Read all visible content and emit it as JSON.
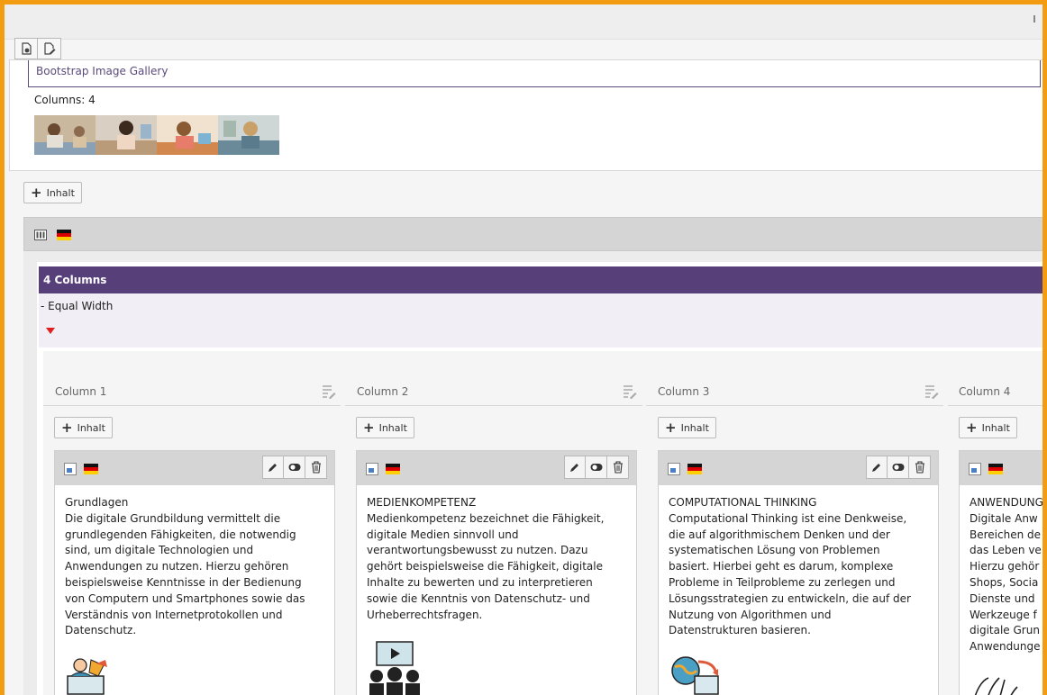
{
  "toolbar": {
    "buttons": [
      {
        "name": "view-icon"
      },
      {
        "name": "edit-page-icon"
      }
    ]
  },
  "gallery": {
    "title": "Bootstrap Image Gallery",
    "columns_label": "Columns: 4",
    "thumbnail_count": 4
  },
  "add_content_label": "Inhalt",
  "grid": {
    "header_icons": [
      "grid-element-icon",
      "german-flag-icon"
    ],
    "title": "4 Columns",
    "subtitle": "- Equal Width"
  },
  "columns": [
    {
      "title": "Column 1",
      "add_label": "Inhalt",
      "heading": "Grundlagen",
      "text": "Die digitale Grundbildung vermittelt die\ngrundlegenden Fähigkeiten, die notwendig\nsind, um digitale Technologien und\nAnwendungen zu nutzen. Hierzu gehören\nbeispielsweise Kenntnisse in der Bedienung\nvon Computern und Smartphones sowie das\nVerständnis von Internetprotokollen und\nDatenschutz."
    },
    {
      "title": "Column 2",
      "add_label": "Inhalt",
      "heading": "MEDIENKOMPETENZ",
      "text": "Medienkompetenz bezeichnet die Fähigkeit,\ndigitale Medien sinnvoll und\nverantwortungsbewusst zu nutzen. Dazu\ngehört beispielsweise die Fähigkeit, digitale\nInhalte zu bewerten und zu interpretieren\nsowie die Kenntnis von Datenschutz- und\nUrheberrechtsfragen."
    },
    {
      "title": "Column 3",
      "add_label": "Inhalt",
      "heading": "COMPUTATIONAL THINKING",
      "text": "Computational Thinking ist eine Denkweise,\ndie auf algorithmischem Denken und der\nsystematischen Lösung von Problemen\nbasiert. Hierbei geht es darum, komplexe\nProbleme in Teilprobleme zu zerlegen und\nLösungsstrategien zu entwickeln, die auf der\nNutzung von Algorithmen und\nDatenstrukturen basieren."
    },
    {
      "title": "Column 4",
      "add_label": "Inhalt",
      "heading": "ANWENDUNG",
      "text": "Digitale Anw\nBereichen de\ndas Leben ve\nHierzu gehör\nShops, Socia\nDienste und\nWerkzeuge f\ndigitale Grun\nAnwendunge"
    }
  ],
  "colors": {
    "frame": "#f39c12",
    "accent_purple": "#573f7a",
    "hide_marker": "#e01e1e"
  }
}
